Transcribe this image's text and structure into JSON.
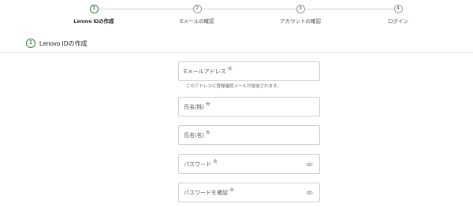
{
  "stepper": {
    "steps": [
      {
        "number": "1",
        "label": "Lenovo IDの作成"
      },
      {
        "number": "2",
        "label": "Eメールの確認"
      },
      {
        "number": "3",
        "label": "アカウントの確認"
      },
      {
        "number": "4",
        "label": "ログイン"
      }
    ],
    "active_step": 1
  },
  "section": {
    "number": "1",
    "title": "Lenovo IDの作成"
  },
  "form": {
    "email": {
      "placeholder": "Eメールアドレス",
      "required_mark": "*"
    },
    "email_helper": "このアドレスに登録確認メールが送信されます。",
    "last_name": {
      "placeholder": "氏名(姓)",
      "required_mark": "*"
    },
    "first_name": {
      "placeholder": "氏名(名)",
      "required_mark": "*"
    },
    "password": {
      "placeholder": "パスワード",
      "required_mark": "*"
    },
    "password_confirm": {
      "placeholder": "パスワードを確認",
      "required_mark": "*"
    }
  },
  "colors": {
    "accent_green": "#2e7d32",
    "border_gray": "#cfcfcf"
  }
}
